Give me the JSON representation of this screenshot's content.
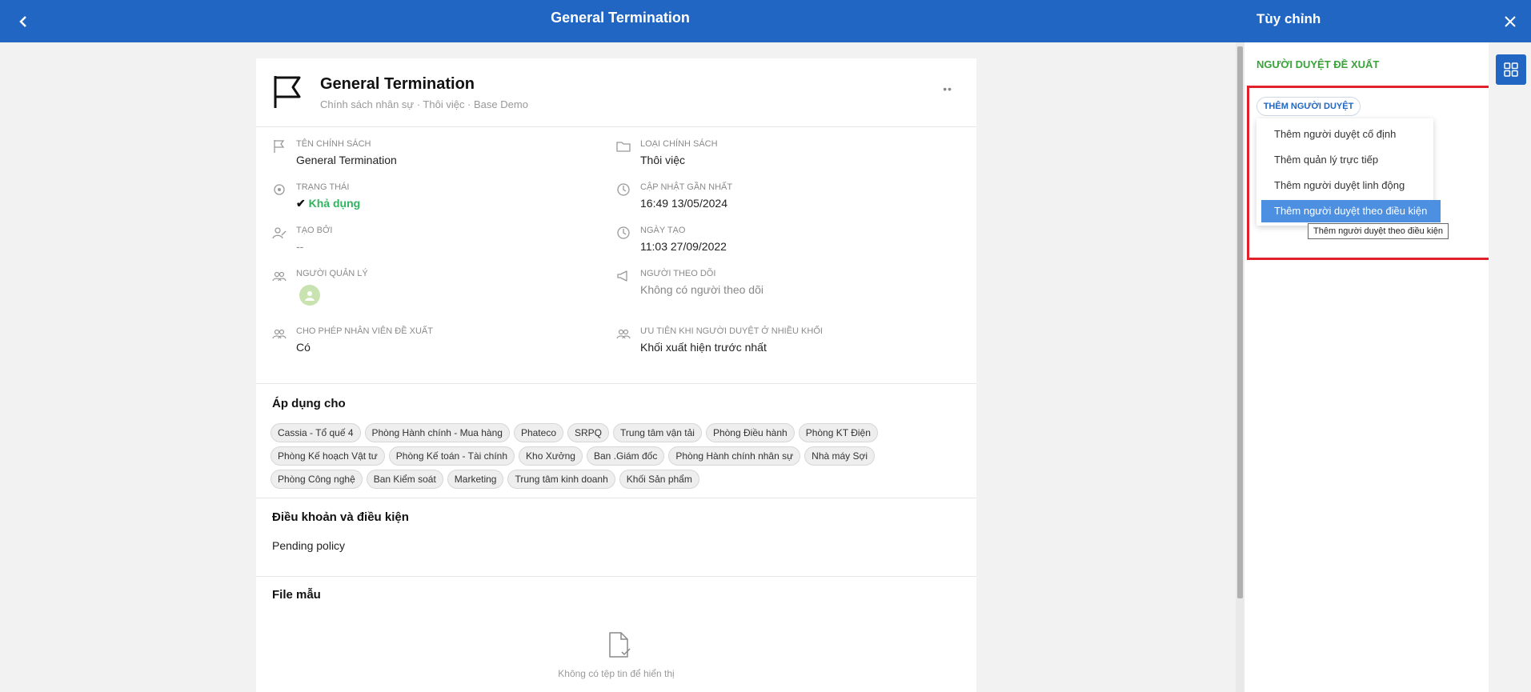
{
  "header": {
    "title": "General Termination"
  },
  "card": {
    "title": "General Termination",
    "subtitle": "Chính sách nhân sự · Thôi việc · Base Demo",
    "fields": {
      "policy_name": {
        "label": "TÊN CHÍNH SÁCH",
        "value": "General Termination"
      },
      "policy_type": {
        "label": "LOẠI CHÍNH SÁCH",
        "value": "Thôi việc"
      },
      "status": {
        "label": "TRẠNG THÁI",
        "value": "Khả dụng"
      },
      "last_updated": {
        "label": "CẬP NHẬT GẦN NHẤT",
        "value": "16:49 13/05/2024"
      },
      "created_by": {
        "label": "TẠO BỞI",
        "value": "--"
      },
      "created_at": {
        "label": "NGÀY TẠO",
        "value": "11:03 27/09/2022"
      },
      "managers": {
        "label": "NGƯỜI QUẢN LÝ"
      },
      "followers": {
        "label": "NGƯỜI THEO DÕI",
        "value": "Không có người theo dõi"
      },
      "allow_propose": {
        "label": "CHO PHÉP NHÂN VIÊN ĐỀ XUẤT",
        "value": "Có"
      },
      "priority": {
        "label": "ƯU TIÊN KHI NGƯỜI DUYỆT Ở NHIỀU KHỐI",
        "value": "Khối xuất hiện trước nhất"
      }
    },
    "apply_title": "Áp dụng cho",
    "apply_tags": [
      "Cassia - Tổ quế 4",
      "Phòng Hành chính - Mua hàng",
      "Phateco",
      "SRPQ",
      "Trung tâm vận tải",
      "Phòng Điều hành",
      "Phòng KT Điện",
      "Phòng Kế hoạch Vật tư",
      "Phòng Kế toán - Tài chính",
      "Kho Xưởng",
      "Ban .Giám đốc",
      "Phòng Hành chính nhân sự",
      "Nhà máy Sợi",
      "Phòng Công nghệ",
      "Ban Kiểm soát",
      "Marketing",
      "Trung tâm kinh doanh",
      "Khối Sản phẩm"
    ],
    "terms_title": "Điều khoản và điều kiện",
    "terms_text": "Pending policy",
    "file_title": "File mẫu",
    "file_empty": "Không có tệp tin để hiển thị"
  },
  "panel": {
    "title": "Tùy chỉnh",
    "section": "NGƯỜI DUYỆT ĐỀ XUẤT",
    "add_button": "THÊM NGƯỜI DUYỆT",
    "menu": [
      "Thêm người duyệt cố định",
      "Thêm quản lý trực tiếp",
      "Thêm người duyệt linh động",
      "Thêm người duyệt theo điều kiện"
    ],
    "tooltip": "Thêm người duyệt theo điều kiện"
  },
  "colors": {
    "primary": "#2066c2",
    "status_green": "#2fb55e",
    "section_green": "#3aa33a",
    "highlight_red": "#e0202a",
    "menu_active": "#4d8fe0"
  }
}
